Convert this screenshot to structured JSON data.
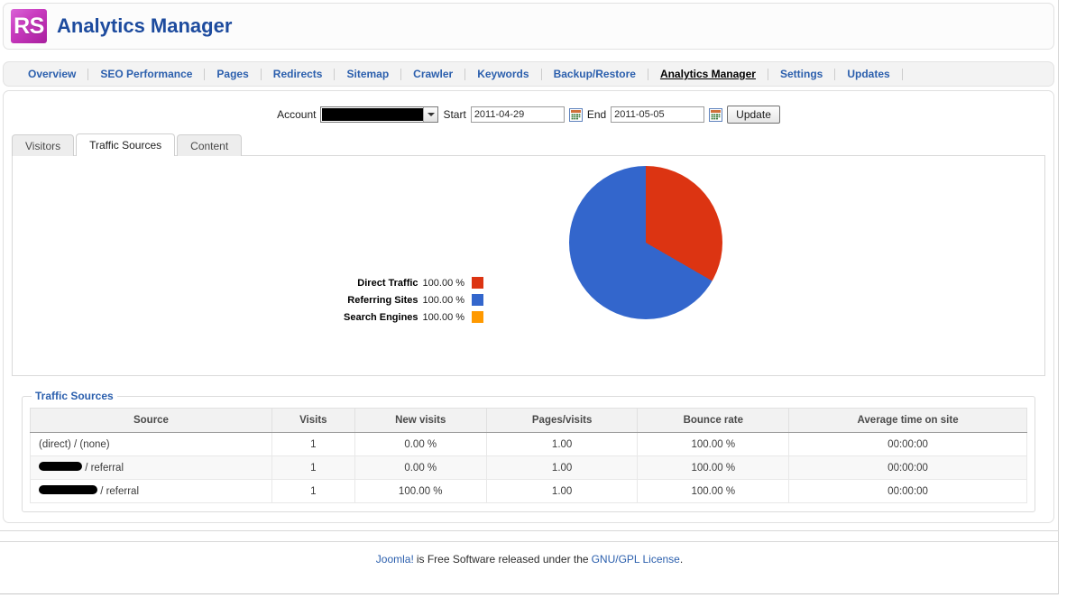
{
  "header": {
    "logo_text": "RS",
    "logo_icon": "rs-logo-icon",
    "title": "Analytics Manager"
  },
  "nav": {
    "items": [
      {
        "label": "Overview",
        "active": false
      },
      {
        "label": "SEO Performance",
        "active": false
      },
      {
        "label": "Pages",
        "active": false
      },
      {
        "label": "Redirects",
        "active": false
      },
      {
        "label": "Sitemap",
        "active": false
      },
      {
        "label": "Crawler",
        "active": false
      },
      {
        "label": "Keywords",
        "active": false
      },
      {
        "label": "Backup/Restore",
        "active": false
      },
      {
        "label": "Analytics Manager",
        "active": true
      },
      {
        "label": "Settings",
        "active": false
      },
      {
        "label": "Updates",
        "active": false
      }
    ]
  },
  "controls": {
    "account_label": "Account",
    "account_value": "",
    "account_redacted": true,
    "start_label": "Start",
    "start_value": "2011-04-29",
    "start_calendar_icon": "calendar-icon",
    "end_label": "End",
    "end_value": "2011-05-05",
    "end_calendar_icon": "calendar-icon",
    "update_label": "Update"
  },
  "tabs": [
    {
      "label": "Visitors",
      "active": false
    },
    {
      "label": "Traffic Sources",
      "active": true
    },
    {
      "label": "Content",
      "active": false
    }
  ],
  "chart_data": {
    "type": "pie",
    "title": "",
    "legend_position": "left",
    "categories": [
      "Direct Traffic",
      "Referring Sites",
      "Search Engines"
    ],
    "values": [
      33.33,
      66.67,
      0
    ],
    "labels": [
      "100.00 %",
      "100.00 %",
      "100.00 %"
    ],
    "colors": [
      "#dc3412",
      "#3366cc",
      "#ff9900"
    ],
    "legend": [
      {
        "name": "Direct Traffic",
        "value": "100.00 %",
        "color": "#dc3412"
      },
      {
        "name": "Referring Sites",
        "value": "100.00 %",
        "color": "#3366cc"
      },
      {
        "name": "Search Engines",
        "value": "100.00 %",
        "color": "#ff9900"
      }
    ]
  },
  "table": {
    "legend": "Traffic Sources",
    "columns": [
      "Source",
      "Visits",
      "New visits",
      "Pages/visits",
      "Bounce rate",
      "Average time on site"
    ],
    "rows": [
      {
        "source_redacted": false,
        "source_redact_width": 0,
        "source": "(direct) / (none)",
        "visits": "1",
        "new_visits": "0.00 %",
        "pages_visits": "1.00",
        "bounce_rate": "100.00 %",
        "avg_time": "00:00:00"
      },
      {
        "source_redacted": true,
        "source_redact_width": 48,
        "source": " / referral",
        "visits": "1",
        "new_visits": "0.00 %",
        "pages_visits": "1.00",
        "bounce_rate": "100.00 %",
        "avg_time": "00:00:00"
      },
      {
        "source_redacted": true,
        "source_redact_width": 65,
        "source": " / referral",
        "visits": "1",
        "new_visits": "100.00 %",
        "pages_visits": "1.00",
        "bounce_rate": "100.00 %",
        "avg_time": "00:00:00"
      }
    ]
  },
  "footer": {
    "joomla_link": "Joomla!",
    "text": "is Free Software released under the",
    "license_link": "GNU/GPL License",
    "period": "."
  },
  "colors": {
    "brand_blue": "#2b5fad",
    "title_blue": "#1d4b9e",
    "logo_magenta": "#c93bbf",
    "pie_red": "#dc3412",
    "pie_blue": "#3366cc",
    "pie_orange": "#ff9900"
  }
}
